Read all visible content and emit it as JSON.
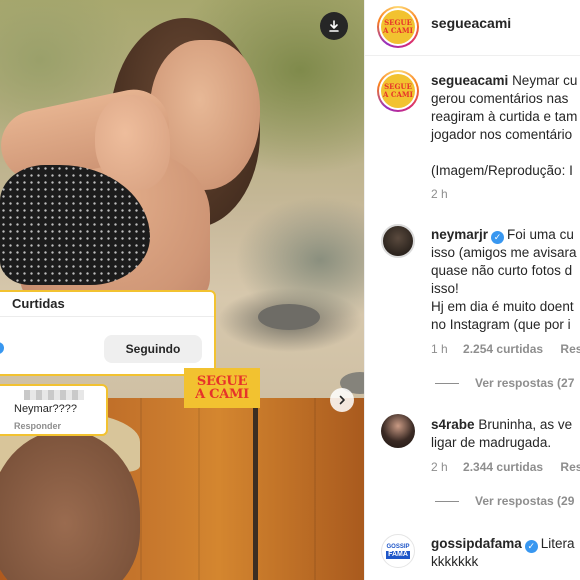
{
  "media": {
    "likes_card": {
      "title": "Curtidas",
      "button": "Seguindo"
    },
    "comment_card": {
      "text": "Neymar????",
      "reply": "Responder"
    },
    "logo_lines": [
      "SEGUE",
      "A CAMI"
    ]
  },
  "header": {
    "username": "segueacami",
    "logo_lines": [
      "SEGUE",
      "A CAMI"
    ]
  },
  "caption": {
    "username": "segueacami",
    "lines": [
      "Neymar cu",
      "gerou comentários nas",
      "reagiram à curtida e tam",
      "jogador nos comentário",
      "",
      "(Imagem/Reprodução: I"
    ],
    "time": "2 h"
  },
  "comments": [
    {
      "username": "neymarjr",
      "verified": true,
      "lines": [
        "Foi uma cu",
        "isso (amigos me avisara",
        "quase não curto fotos d",
        "isso!",
        "Hj em dia é muito doent",
        "no Instagram (que por i"
      ],
      "time": "1 h",
      "likes": "2.254 curtidas",
      "reply": "Resp",
      "view_replies": "Ver respostas (27"
    },
    {
      "username": "s4rabe",
      "verified": false,
      "lines": [
        "Bruninha, as ve",
        "ligar de madrugada."
      ],
      "time": "2 h",
      "likes": "2.344 curtidas",
      "reply": "Resp",
      "view_replies": "Ver respostas (29"
    },
    {
      "username": "gossipdafama",
      "verified": true,
      "lines": [
        "Litera",
        "kkkkkkk"
      ],
      "avatar_lines": [
        "GOSSIP",
        "FAMA"
      ]
    }
  ],
  "colors": {
    "brand_yellow": "#f2c230",
    "brand_red": "#e6332a",
    "verified_blue": "#3897f0",
    "muted_text": "#8e8e8e"
  },
  "icons": {
    "download": "download-icon",
    "next": "chevron-right-icon",
    "verified": "verified-badge-icon"
  }
}
